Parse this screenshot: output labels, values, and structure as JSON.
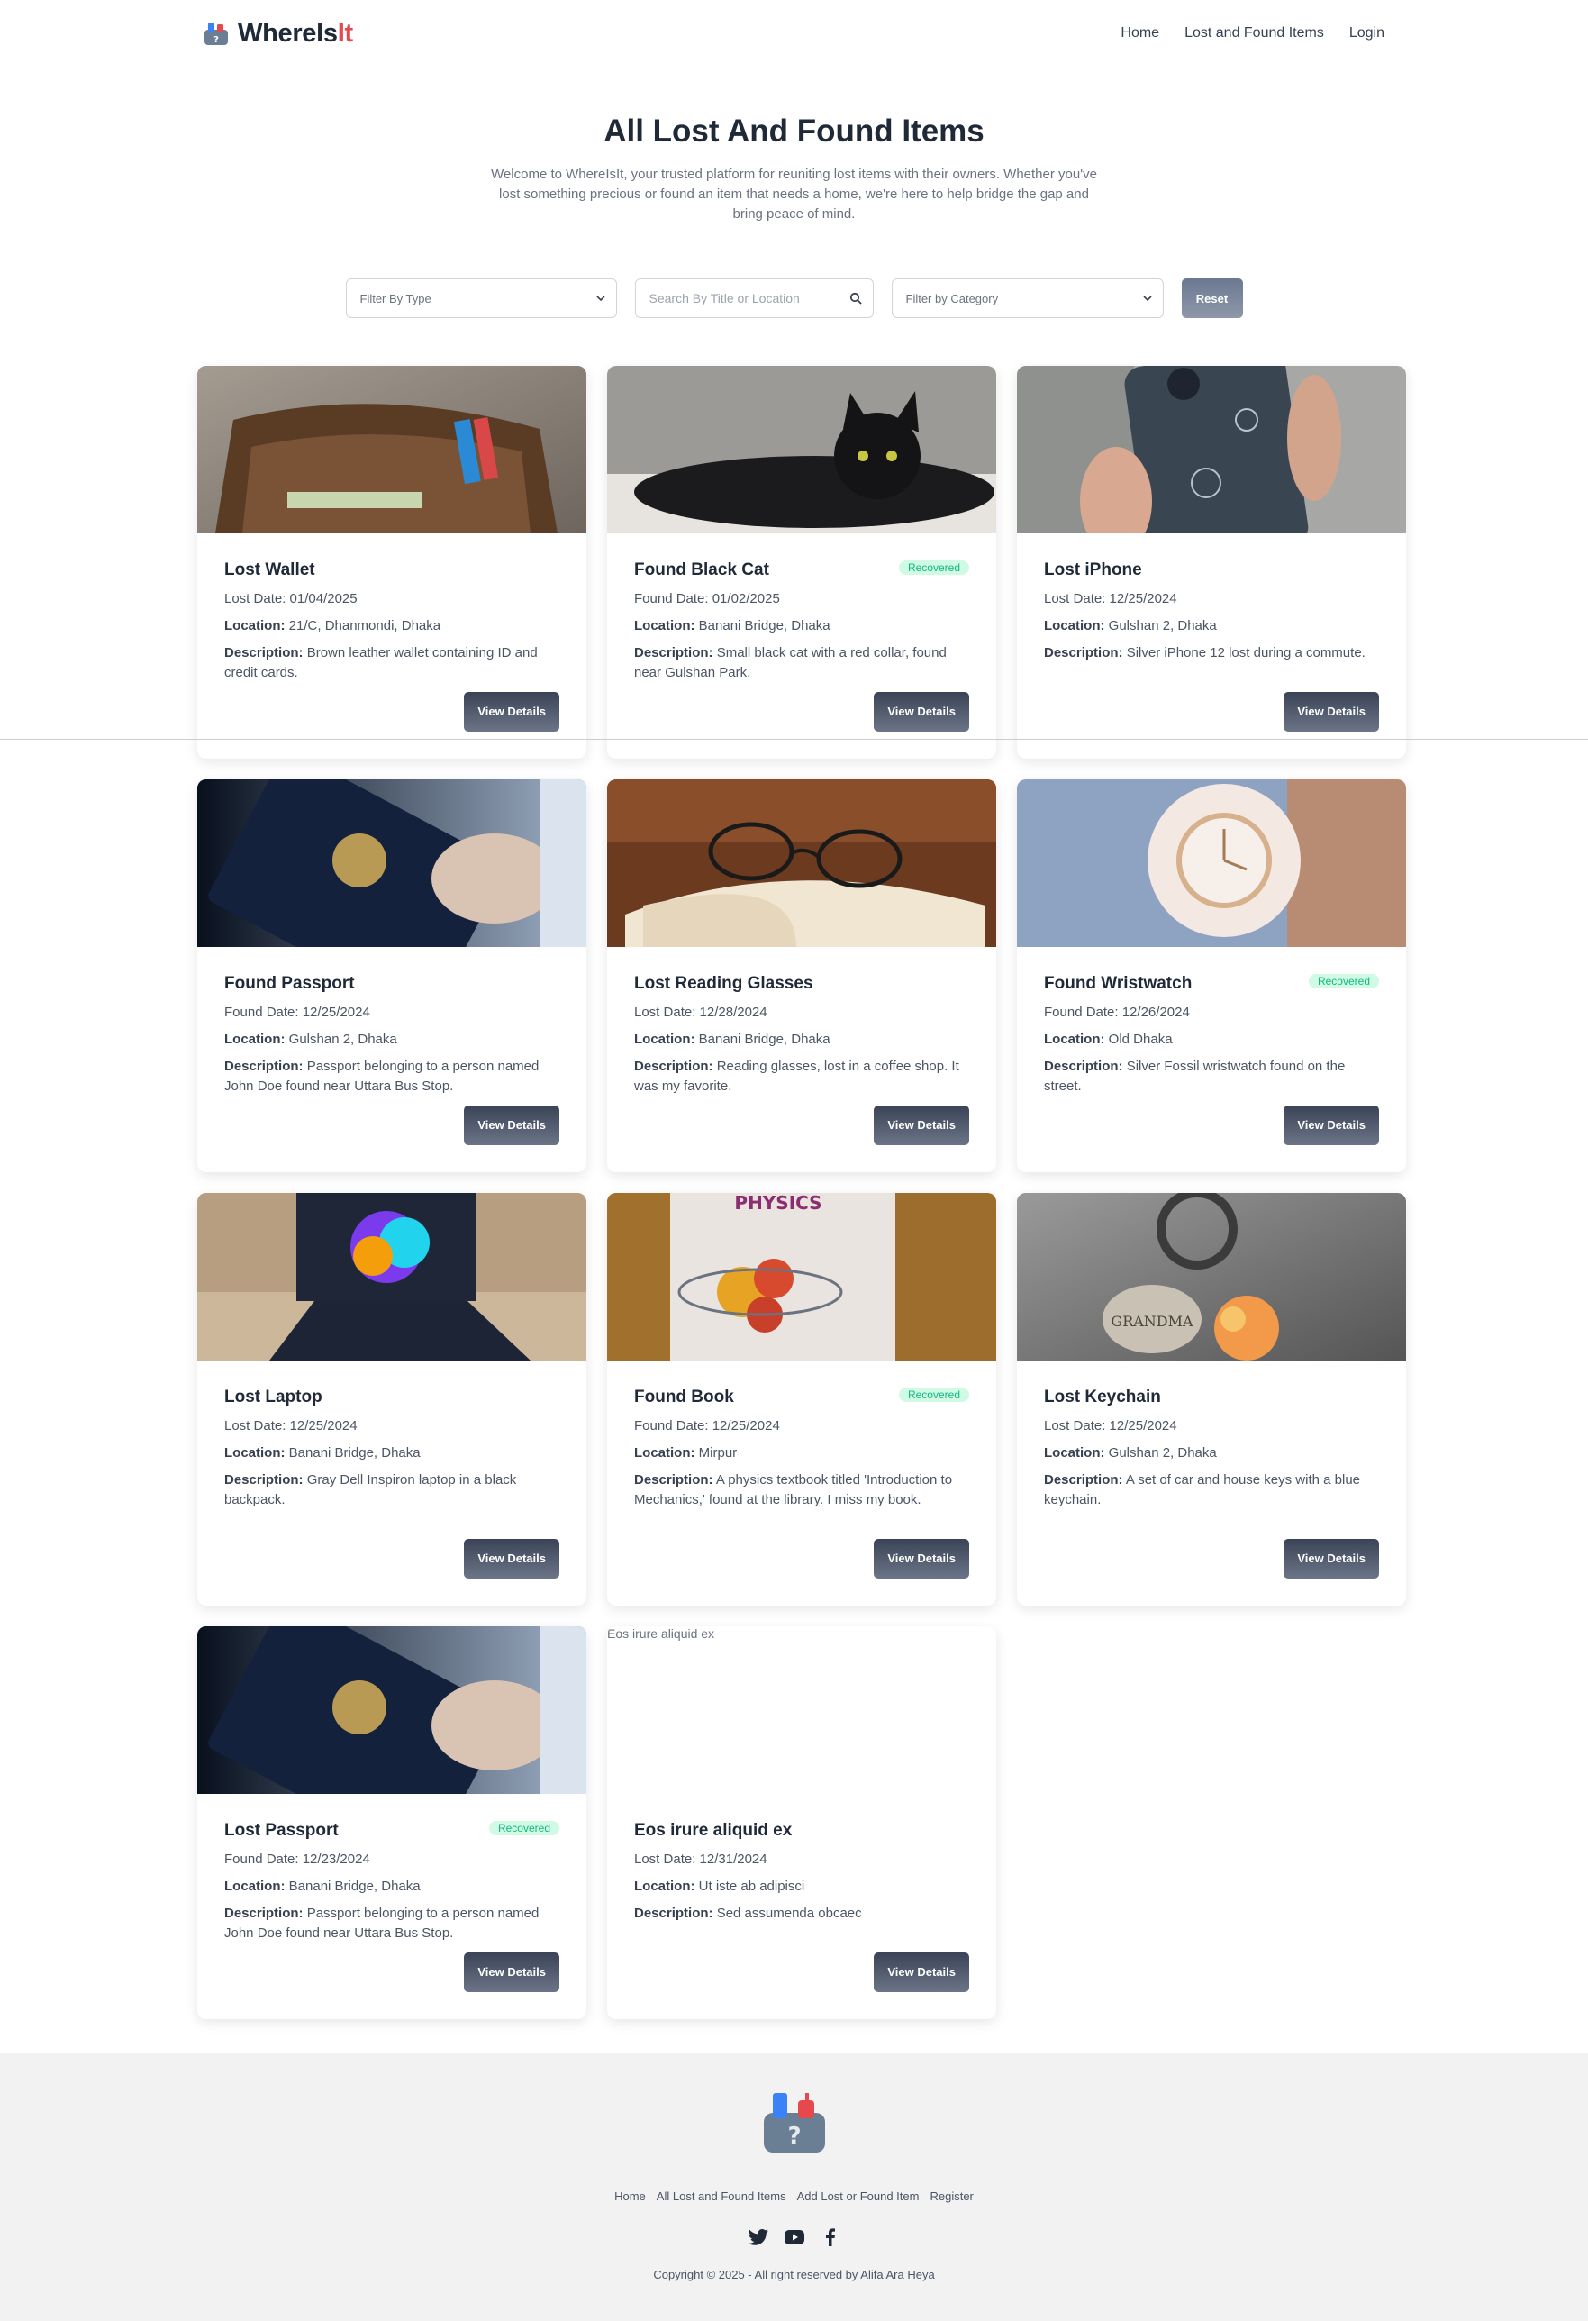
{
  "brand": {
    "name_main": "WhereIs",
    "name_accent": "It",
    "accent_color": "#e5484d"
  },
  "nav": {
    "items": [
      "Home",
      "Lost and Found Items",
      "Login"
    ]
  },
  "hero": {
    "title": "All Lost And Found Items",
    "description": "Welcome to WhereIsIt, your trusted platform for reuniting lost items with their owners. Whether you've lost something precious or found an item that needs a home, we're here to help bridge the gap and bring peace of mind."
  },
  "filters": {
    "type_placeholder": "Filter By Type",
    "search_placeholder": "Search By Title or Location",
    "category_placeholder": "Filter by Category",
    "reset_label": "Reset"
  },
  "labels": {
    "location": "Location:",
    "description": "Description:",
    "view_details": "View Details",
    "recovered": "Recovered"
  },
  "cards": [
    {
      "title": "Lost Wallet",
      "date": "Lost Date: 01/04/2025",
      "location": "21/C, Dhanmondi, Dhaka",
      "description": "Brown leather wallet containing ID and credit cards.",
      "recovered": false,
      "image": "wallet"
    },
    {
      "title": "Found Black Cat",
      "date": "Found Date: 01/02/2025",
      "location": "Banani Bridge, Dhaka",
      "description": "Small black cat with a red collar, found near Gulshan Park.",
      "recovered": true,
      "image": "cat"
    },
    {
      "title": "Lost iPhone",
      "date": "Lost Date: 12/25/2024",
      "location": "Gulshan 2, Dhaka",
      "description": "Silver iPhone 12 lost during a commute.",
      "recovered": false,
      "image": "iphone"
    },
    {
      "title": "Found Passport",
      "date": "Found Date: 12/25/2024",
      "location": "Gulshan 2, Dhaka",
      "description": "Passport belonging to a person named John Doe found near Uttara Bus Stop.",
      "recovered": false,
      "image": "passport"
    },
    {
      "title": "Lost Reading Glasses",
      "date": "Lost Date: 12/28/2024",
      "location": "Banani Bridge, Dhaka",
      "description": "Reading glasses, lost in a coffee shop. It was my favorite.",
      "recovered": false,
      "image": "glasses"
    },
    {
      "title": "Found Wristwatch",
      "date": "Found Date: 12/26/2024",
      "location": "Old Dhaka",
      "description": "Silver Fossil wristwatch found on the street.",
      "recovered": true,
      "image": "watch"
    },
    {
      "title": "Lost Laptop",
      "date": "Lost Date: 12/25/2024",
      "location": "Banani Bridge, Dhaka",
      "description": "Gray Dell Inspiron laptop in a black backpack.",
      "recovered": false,
      "image": "laptop"
    },
    {
      "title": "Found Book",
      "date": "Found Date: 12/25/2024",
      "location": "Mirpur",
      "description": "A physics textbook titled 'Introduction to Mechanics,' found at the library. I miss my book.",
      "recovered": true,
      "image": "book",
      "image_text": "PHYSICS"
    },
    {
      "title": "Lost Keychain",
      "date": "Lost Date: 12/25/2024",
      "location": "Gulshan 2, Dhaka",
      "description": "A set of car and house keys with a blue keychain.",
      "recovered": false,
      "image": "keychain",
      "image_text": "GRANDMA"
    },
    {
      "title": "Lost Passport",
      "date": "Found Date: 12/23/2024",
      "location": "Banani Bridge, Dhaka",
      "description": "Passport belonging to a person named John Doe found near Uttara Bus Stop.",
      "recovered": true,
      "image": "passport"
    },
    {
      "title": "Eos irure aliquid ex",
      "date": "Lost Date: 12/31/2024",
      "location": "Ut iste ab adipisci",
      "description": "Sed assumenda obcaec",
      "recovered": false,
      "image": "broken",
      "image_alt": "Eos irure aliquid ex"
    }
  ],
  "footer": {
    "links": [
      "Home",
      "All Lost and Found Items",
      "Add Lost or Found Item",
      "Register"
    ],
    "socials": [
      "twitter-icon",
      "youtube-icon",
      "facebook-icon"
    ],
    "copyright": "Copyright © 2025 - All right reserved by Alifa Ara Heya"
  },
  "colors": {
    "button": "#3b4456",
    "badge_bg": "#d1fae5",
    "badge_text": "#10b981",
    "footer_bg": "#f2f2f3"
  }
}
